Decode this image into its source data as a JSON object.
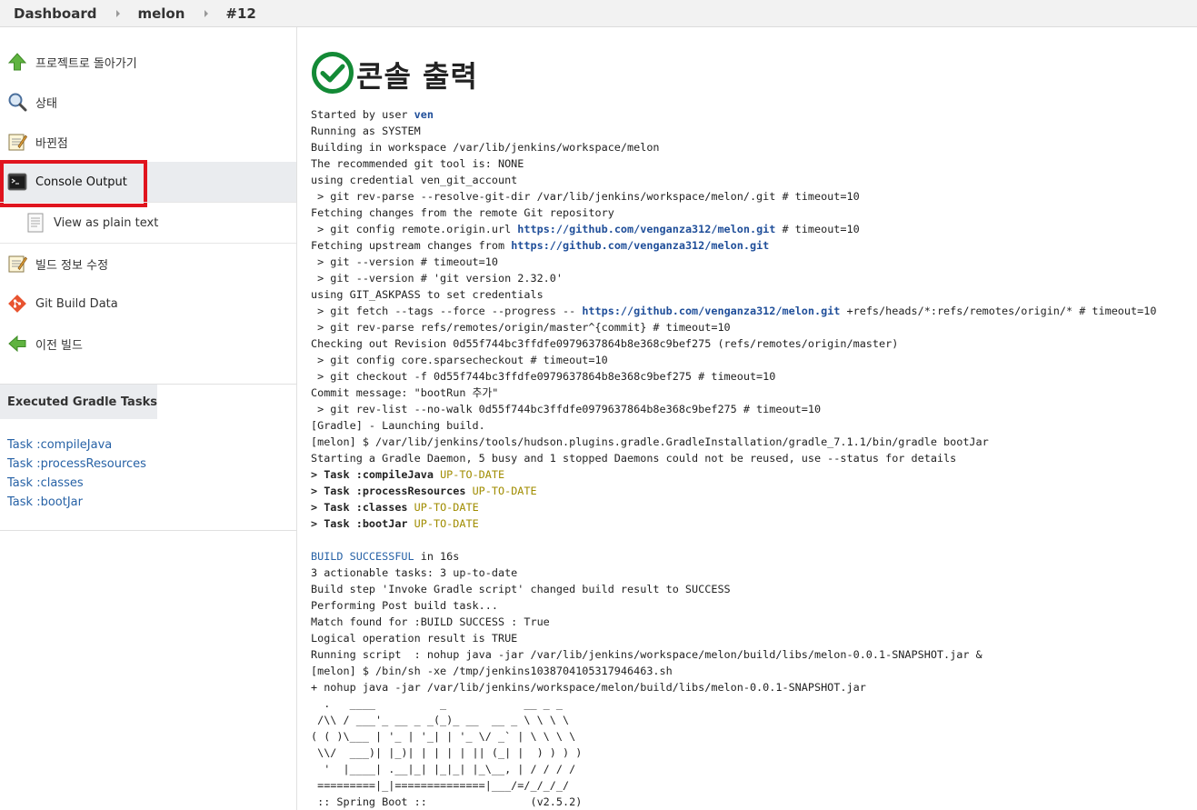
{
  "breadcrumb": {
    "items": [
      "Dashboard",
      "melon",
      "#12"
    ]
  },
  "sidebar": {
    "items": [
      {
        "label": "프로젝트로 돌아가기",
        "icon": "up-arrow-icon"
      },
      {
        "label": "상태",
        "icon": "magnifier-icon"
      },
      {
        "label": "바뀐점",
        "icon": "notepad-icon"
      },
      {
        "label": "Console Output",
        "icon": "terminal-icon"
      },
      {
        "label": "View as plain text",
        "icon": "document-icon"
      },
      {
        "label": "빌드 정보 수정",
        "icon": "notepad-icon"
      },
      {
        "label": "Git Build Data",
        "icon": "git-icon"
      },
      {
        "label": "이전 빌드",
        "icon": "left-arrow-icon"
      }
    ]
  },
  "gradle": {
    "header": "Executed Gradle Tasks",
    "tasks": [
      "Task :compileJava",
      "Task :processResources",
      "Task :classes",
      "Task :bootJar"
    ]
  },
  "main": {
    "title": "콘솔 출력"
  },
  "console": {
    "l01a": "Started by user ",
    "l01_user": "ven",
    "l02": "Running as SYSTEM",
    "l03": "Building in workspace /var/lib/jenkins/workspace/melon",
    "l04": "The recommended git tool is: NONE",
    "l05": "using credential ven_git_account",
    "l06": " > git rev-parse --resolve-git-dir /var/lib/jenkins/workspace/melon/.git # timeout=10",
    "l07": "Fetching changes from the remote Git repository",
    "l08a": " > git config remote.origin.url ",
    "l08_url": "https://github.com/venganza312/melon.git",
    "l08b": " # timeout=10",
    "l09a": "Fetching upstream changes from ",
    "l09_url": "https://github.com/venganza312/melon.git",
    "l10": " > git --version # timeout=10",
    "l11": " > git --version # 'git version 2.32.0'",
    "l12": "using GIT_ASKPASS to set credentials",
    "l13a": " > git fetch --tags --force --progress -- ",
    "l13_url": "https://github.com/venganza312/melon.git",
    "l13b": " +refs/heads/*:refs/remotes/origin/* # timeout=10",
    "l14": " > git rev-parse refs/remotes/origin/master^{commit} # timeout=10",
    "l15": "Checking out Revision 0d55f744bc3ffdfe0979637864b8e368c9bef275 (refs/remotes/origin/master)",
    "l16": " > git config core.sparsecheckout # timeout=10",
    "l17": " > git checkout -f 0d55f744bc3ffdfe0979637864b8e368c9bef275 # timeout=10",
    "l18": "Commit message: \"bootRun 추가\"",
    "l19": " > git rev-list --no-walk 0d55f744bc3ffdfe0979637864b8e368c9bef275 # timeout=10",
    "l20": "[Gradle] - Launching build.",
    "l21": "[melon] $ /var/lib/jenkins/tools/hudson.plugins.gradle.GradleInstallation/gradle_7.1.1/bin/gradle bootJar",
    "l22": "Starting a Gradle Daemon, 5 busy and 1 stopped Daemons could not be reused, use --status for details",
    "t1": "> Task :compileJava",
    "t2": "> Task :processResources",
    "t3": "> Task :classes",
    "t4": "> Task :bootJar",
    "uptodate": "UP-TO-DATE",
    "l27a": "BUILD SUCCESSFUL",
    "l27b": " in 16s",
    "l28": "3 actionable tasks: 3 up-to-date",
    "l29": "Build step 'Invoke Gradle script' changed build result to SUCCESS",
    "l30": "Performing Post build task...",
    "l31": "Match found for :BUILD SUCCESS : True",
    "l32": "Logical operation result is TRUE",
    "l33": "Running script  : nohup java -jar /var/lib/jenkins/workspace/melon/build/libs/melon-0.0.1-SNAPSHOT.jar &",
    "l34": "[melon] $ /bin/sh -xe /tmp/jenkins10387041053179464 63.sh",
    "l35": "+ nohup java -jar /var/lib/jenkins/workspace/melon/build/libs/melon-0.0.1-SNAPSHOT.jar",
    "b1": "  .   ____          _            __ _ _",
    "b2": " /\\\\ / ___'_ __ _ _(_)_ __  __ _ \\ \\ \\ \\",
    "b3": "( ( )\\___ | '_ | '_| | '_ \\/ _` | \\ \\ \\ \\",
    "b4": " \\\\/  ___)| |_)| | | | | || (_| |  ) ) ) )",
    "b5": "  '  |____| .__|_| |_|_| |_\\__, | / / / /",
    "b6": " =========|_|==============|___/=/_/_/_/",
    "b7": " :: Spring Boot ::                (v2.5.2)"
  }
}
